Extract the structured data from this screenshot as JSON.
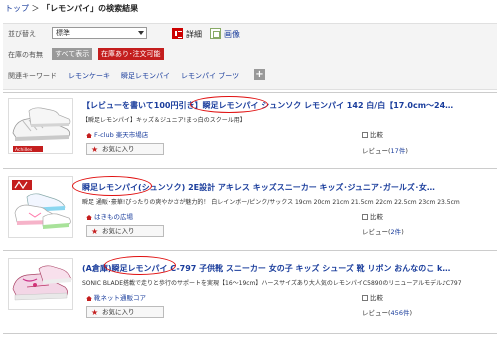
{
  "breadcrumb": {
    "home": "トップ",
    "separator": "＞",
    "current": "「レモンパイ」の検索結果"
  },
  "filters": {
    "sort_label": "並び替え",
    "sort_value": "標準",
    "view_detail": "詳細",
    "view_image": "画像",
    "stock_label": "在庫の有無",
    "stock_all": "すべて表示",
    "stock_available": "在庫あり･注文可能",
    "related_label": "関連キーワード",
    "related": [
      "レモンケーキ",
      "瞬足レモンパイ",
      "レモンパイ ブーツ"
    ],
    "more": "+"
  },
  "products": [
    {
      "title": "【レビューを書いて100円引き】瞬足レモンパイ シュンソク レモンパイ 142 白/白【17.0cm〜24…",
      "desc": "【瞬足レモンパイ】キッズ＆ジュニア!まっ白のスクール用】",
      "shop": "F-club 楽天市場店",
      "fav": "お気に入り",
      "compare": "比較",
      "review_label": "レビュー",
      "review_count": "17件"
    },
    {
      "title": "瞬足レモンパイ(シュンソク) 2E設計 アキレス キッズスニーカー キッズ･ジュニア･ガールズ･女…",
      "desc": "瞬足 通販･豪華!ぴったりの爽やかさが魅力的！ 白レインボー/ピンク/サックス 19cm 20cm 21cm 21.5cm 22cm 22.5cm 23cm 23.5cm",
      "shop": "はきもの広場",
      "fav": "お気に入り",
      "compare": "比較",
      "review_label": "レビュー",
      "review_count": "2件"
    },
    {
      "title": "(A倉庫)瞬足レモンパイ C-797 子供靴 スニーカー 女の子 キッズ シューズ 靴 リボン おんなのこ k…",
      "desc": "SONIC BLADE搭載で走りと歩行のサポートを実現【16〜19cm】ハースサイズあり大人気のレモンパイC5890のリニューアルモデル♪C797",
      "shop": "靴ネット通販コア",
      "fav": "お気に入り",
      "compare": "比較",
      "review_label": "レビュー",
      "review_count": "456件"
    }
  ],
  "thumb_brand_text": "Achilles",
  "colors": {
    "accent": "#c41e1e",
    "link": "#1a3d9c",
    "highlight_oval": "#e01010"
  }
}
